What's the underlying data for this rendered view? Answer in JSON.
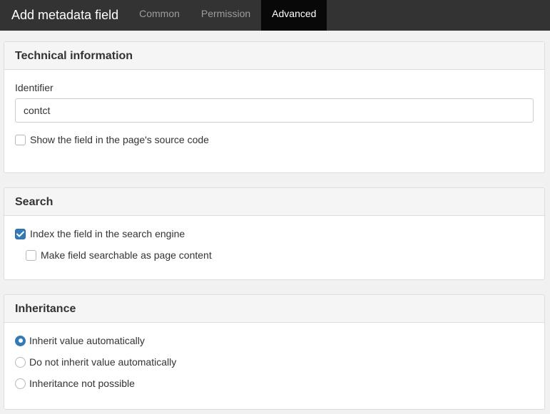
{
  "header": {
    "title": "Add metadata field",
    "tabs": [
      {
        "label": "Common",
        "active": false
      },
      {
        "label": "Permission",
        "active": false
      },
      {
        "label": "Advanced",
        "active": true
      }
    ]
  },
  "technical": {
    "heading": "Technical information",
    "identifier_label": "Identifier",
    "identifier_value": "contct",
    "show_in_source_label": "Show the field in the page's source code",
    "show_in_source_checked": false
  },
  "search": {
    "heading": "Search",
    "index_label": "Index the field in the search engine",
    "index_checked": true,
    "searchable_label": "Make field searchable as page content",
    "searchable_checked": false
  },
  "inheritance": {
    "heading": "Inheritance",
    "options": [
      {
        "label": "Inherit value automatically",
        "selected": true
      },
      {
        "label": "Do not inherit value automatically",
        "selected": false
      },
      {
        "label": "Inheritance not possible",
        "selected": false
      }
    ]
  },
  "colors": {
    "topbar": "#333333",
    "active_tab": "#080808",
    "accent": "#337ab7"
  }
}
